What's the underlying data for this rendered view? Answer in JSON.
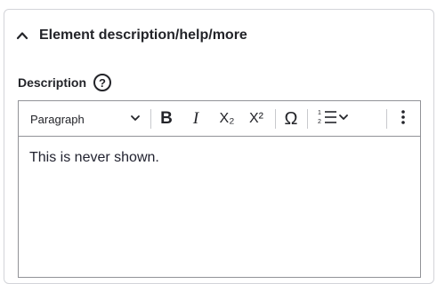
{
  "section": {
    "title": "Element description/help/more",
    "expanded": true
  },
  "field": {
    "label": "Description",
    "help_symbol": "?"
  },
  "toolbar": {
    "heading_select": "Paragraph",
    "bold": "B",
    "italic": "I",
    "subscript": "X₂",
    "superscript": "X²",
    "special_chars": "Ω",
    "icons": {
      "collapse": "chevron-up-icon",
      "dropdown": "chevron-down-icon",
      "list": "numbered-list-icon",
      "more": "vertical-dots-icon"
    }
  },
  "editor": {
    "content": "This is never shown."
  }
}
